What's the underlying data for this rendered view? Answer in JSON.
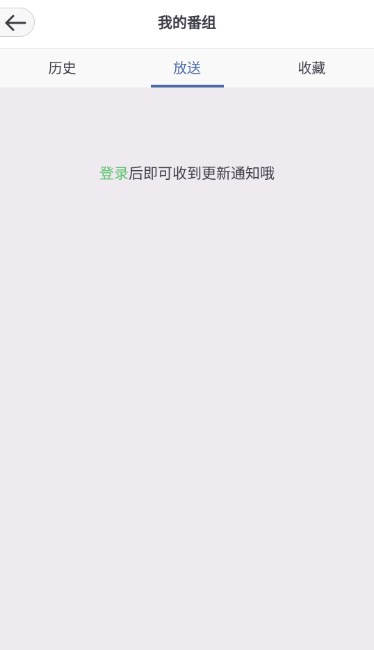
{
  "header": {
    "title": "我的番组",
    "back_icon": "arrow-left-icon"
  },
  "tabs": [
    {
      "label": "历史",
      "active": false
    },
    {
      "label": "放送",
      "active": true
    },
    {
      "label": "收藏",
      "active": false
    }
  ],
  "notice": {
    "login_link": "登录",
    "message": "后即可收到更新通知哦"
  },
  "colors": {
    "accent": "#4a6aa8",
    "login_link": "#5bc26e",
    "background": "#efeaef"
  }
}
